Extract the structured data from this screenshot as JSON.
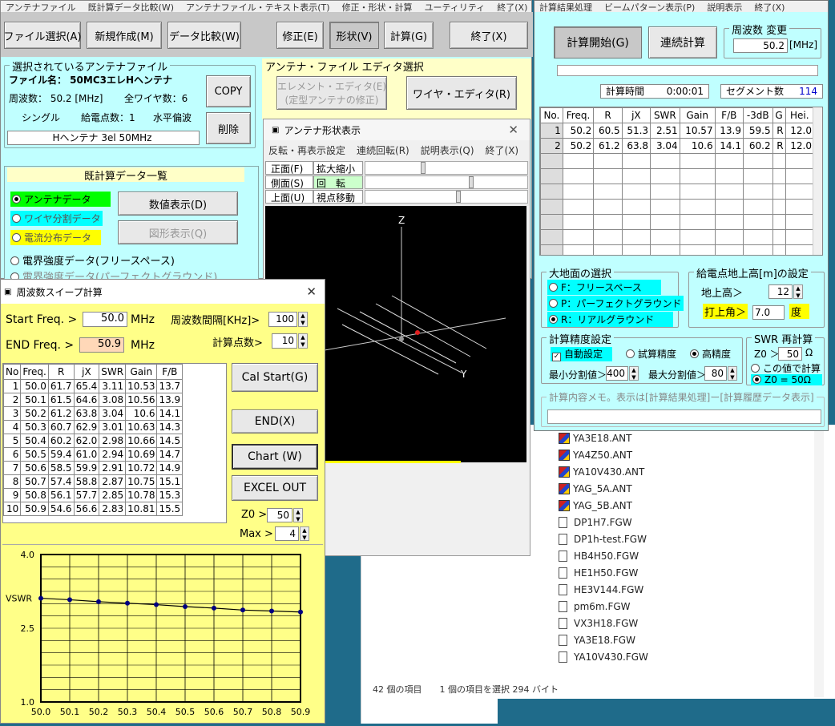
{
  "main": {
    "menu": [
      "アンテナファイル",
      "既計算データ比較(W)",
      "アンテナファイル・テキスト表示(T)",
      "修正・形状・計算",
      "ユーティリティ",
      "終了(X)"
    ],
    "toolbar": {
      "file_select": "ファイル選択(A)",
      "new_create": "新規作成(M)",
      "data_compare": "データ比較(W)",
      "modify": "修正(E)",
      "shape": "形状(V)",
      "calc": "計算(G)",
      "exit": "終了(X)"
    },
    "selected_file": {
      "group_title": "選択されているアンテナファイル",
      "filename": "ファイル名：  50MC3エレHヘンテナ",
      "freq": "周波数：  50.2 [MHz]",
      "wires": "全ワイヤ数：6",
      "single": "シングル",
      "feed_points": "給電点数：1",
      "polarization": "水平偏波",
      "description": "Hヘンテナ 3el 50MHz",
      "copy": "COPY",
      "delete": "削除"
    },
    "editor": {
      "group_title": "アンテナ・ファイル  エディタ選択",
      "element_editor": "エレメント・エディタ(E)",
      "element_editor_sub": "(定型アンテナの修正)",
      "wire_editor": "ワイヤ・エディタ(R)"
    },
    "computed": {
      "title": "既計算データ一覧",
      "items": [
        "アンテナデータ",
        "ワイヤ分割データ",
        "電流分布データ",
        "電界強度データ(フリースペース)",
        "電界強度データ(パーフェクトグラウンド)"
      ],
      "numeric_btn": "数値表示(D)",
      "graph_btn": "図形表示(Q)"
    }
  },
  "shape_win": {
    "title": "アンテナ形状表示",
    "menu": [
      "反転・再表示設定",
      "連続回転(R)",
      "説明表示(Q)",
      "終了(X)"
    ],
    "rows": [
      {
        "left": "正面(F)",
        "right": "拡大縮小"
      },
      {
        "left": "側面(S)",
        "right": "回　転"
      },
      {
        "left": "上面(U)",
        "right": "視点移動"
      }
    ],
    "axis_z": "Z",
    "axis_y": "Y"
  },
  "calc_win": {
    "menu": [
      "計算結果処理",
      "ビームパターン表示(P)",
      "説明表示",
      "終了(X)"
    ],
    "start_btn": "計算開始(G)",
    "cont_btn": "連続計算",
    "freq_change_title": "周波数  変更",
    "freq_value": "50.2",
    "freq_unit": "[MHz]",
    "calc_time_label": "計算時間",
    "calc_time": "0:00:01",
    "segment_label": "セグメント数",
    "segment_value": "114",
    "table_headers": [
      "No.",
      "Freq.",
      "R",
      "jX",
      "SWR",
      "Gain",
      "F/B",
      "-3dB",
      "G",
      "Hei."
    ],
    "rows": [
      [
        "1",
        "50.2",
        "60.5",
        "51.3",
        "2.51",
        "10.57",
        "13.9",
        "59.5",
        "R",
        "12.0"
      ],
      [
        "2",
        "50.2",
        "61.2",
        "63.8",
        "3.04",
        "10.6",
        "14.1",
        "60.2",
        "R",
        "12.0"
      ]
    ],
    "ground_title": "大地面の選択",
    "ground_opts": [
      "F：フリースペース",
      "P：パーフェクトグラウンド",
      "R：リアルグラウンド"
    ],
    "height_title": "給電点地上高[m]の設定",
    "height_label": "地上高＞",
    "height_value": "12",
    "elev_label": "打上角＞",
    "elev_value": "7.0",
    "elev_unit": "度",
    "prec_title": "計算精度設定",
    "auto": "自動設定",
    "trial": "試算精度",
    "high": "高精度",
    "min_div_label": "最小分割値＞",
    "min_div": "400",
    "max_div_label": "最大分割値＞",
    "max_div": "80",
    "swr_title": "SWR  再計算",
    "z0_label": "Z0 ＞",
    "z0_value": "50",
    "z0_unit": "Ω",
    "this_val": "この値で計算",
    "z0_50": "Z0 = 50Ω",
    "memo_title": "計算内容メモ。表示は[計算結果処理]ー[計算履歴データ表示]"
  },
  "sweep_win": {
    "title": "周波数スイープ計算",
    "start_label": "Start Freq. >",
    "start_value": "50.0",
    "mhz": "MHz",
    "end_label": "END Freq. >",
    "end_value": "50.9",
    "interval_label": "周波数間隔[KHz]>",
    "interval_value": "100",
    "points_label": "計算点数>",
    "points_value": "10",
    "headers": [
      "No",
      "Freq.",
      "R",
      "jX",
      "SWR",
      "Gain",
      "F/B"
    ],
    "rows": [
      [
        "1",
        "50.0",
        "61.7",
        "65.4",
        "3.11",
        "10.53",
        "13.7"
      ],
      [
        "2",
        "50.1",
        "61.5",
        "64.6",
        "3.08",
        "10.56",
        "13.9"
      ],
      [
        "3",
        "50.2",
        "61.2",
        "63.8",
        "3.04",
        "10.6",
        "14.1"
      ],
      [
        "4",
        "50.3",
        "60.7",
        "62.9",
        "3.01",
        "10.63",
        "14.3"
      ],
      [
        "5",
        "50.4",
        "60.2",
        "62.0",
        "2.98",
        "10.66",
        "14.5"
      ],
      [
        "6",
        "50.5",
        "59.4",
        "61.0",
        "2.94",
        "10.69",
        "14.7"
      ],
      [
        "7",
        "50.6",
        "58.5",
        "59.9",
        "2.91",
        "10.72",
        "14.9"
      ],
      [
        "8",
        "50.7",
        "57.4",
        "58.8",
        "2.87",
        "10.75",
        "15.1"
      ],
      [
        "9",
        "50.8",
        "56.1",
        "57.7",
        "2.85",
        "10.78",
        "15.3"
      ],
      [
        "10",
        "50.9",
        "54.6",
        "56.6",
        "2.83",
        "10.81",
        "15.5"
      ]
    ],
    "cal_start": "Cal Start(G)",
    "end_btn": "END(X)",
    "chart_btn": "Chart (W)",
    "excel_btn": "EXCEL OUT",
    "z0_label": "Z0 >",
    "z0_value": "50",
    "max_label": "Max >",
    "max_value": "4"
  },
  "chart_data": {
    "type": "line",
    "x": [
      50.0,
      50.1,
      50.2,
      50.3,
      50.4,
      50.5,
      50.6,
      50.7,
      50.8,
      50.9
    ],
    "series": [
      {
        "values": [
          3.11,
          3.08,
          3.04,
          3.01,
          2.98,
          2.94,
          2.91,
          2.87,
          2.85,
          2.83
        ]
      }
    ],
    "ylabel": "VSWR",
    "yticks": [
      "4.0",
      "2.5",
      "1.0"
    ],
    "xticks": [
      "50.0",
      "50.1",
      "50.2",
      "50.3",
      "50.4",
      "50.5",
      "50.6",
      "50.7",
      "50.8",
      "50.9"
    ],
    "ylim": [
      1,
      4
    ],
    "xlim": [
      50.0,
      50.9
    ],
    "grid": true
  },
  "explorer": {
    "ant_files": [
      "YA3E18.ANT",
      "YA4Z50.ANT",
      "YA10V430.ANT",
      "YAG_5A.ANT",
      "YAG_5B.ANT"
    ],
    "fgw_files": [
      "DP1H7.FGW",
      "DP1h-test.FGW",
      "HB4H50.FGW",
      "HE1H50.FGW",
      "HE3V144.FGW",
      "pm6m.FGW",
      "VX3H18.FGW",
      "YA3E18.FGW",
      "YA10V430.FGW"
    ],
    "status_count": "42 個の項目",
    "status_sel": "1 個の項目を選択  294 バイト"
  }
}
